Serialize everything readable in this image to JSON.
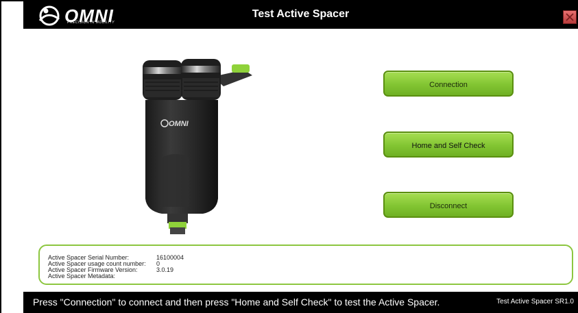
{
  "window": {
    "title": "Test Active Spacer",
    "logo_text": "OMNI",
    "logo_tagline": "PRECISION IN MOBILITY",
    "close_icon": "close-icon"
  },
  "product_image": {
    "brand_text": "OMNI"
  },
  "buttons": {
    "connection": "Connection",
    "home_self_check": "Home and Self Check",
    "disconnect": "Disconnect"
  },
  "info": {
    "serial_label": "Active Spacer Serial Number:",
    "serial_value": "16100004",
    "usage_label": "Active Spacer usage count number:",
    "usage_value": "0",
    "firmware_label": "Active Spacer Firmware Version:",
    "firmware_value": "3.0.19",
    "metadata_label": "Active Spacer Metadata:",
    "metadata_value": ""
  },
  "status": {
    "message": "Press \"Connection\" to connect and then press \"Home and Self Check\" to test the Active Spacer.",
    "version": "Test Active Spacer SR1.0"
  },
  "colors": {
    "button_green": "#82c532",
    "border_green": "#8cc63f",
    "background_dark": "#000000"
  }
}
